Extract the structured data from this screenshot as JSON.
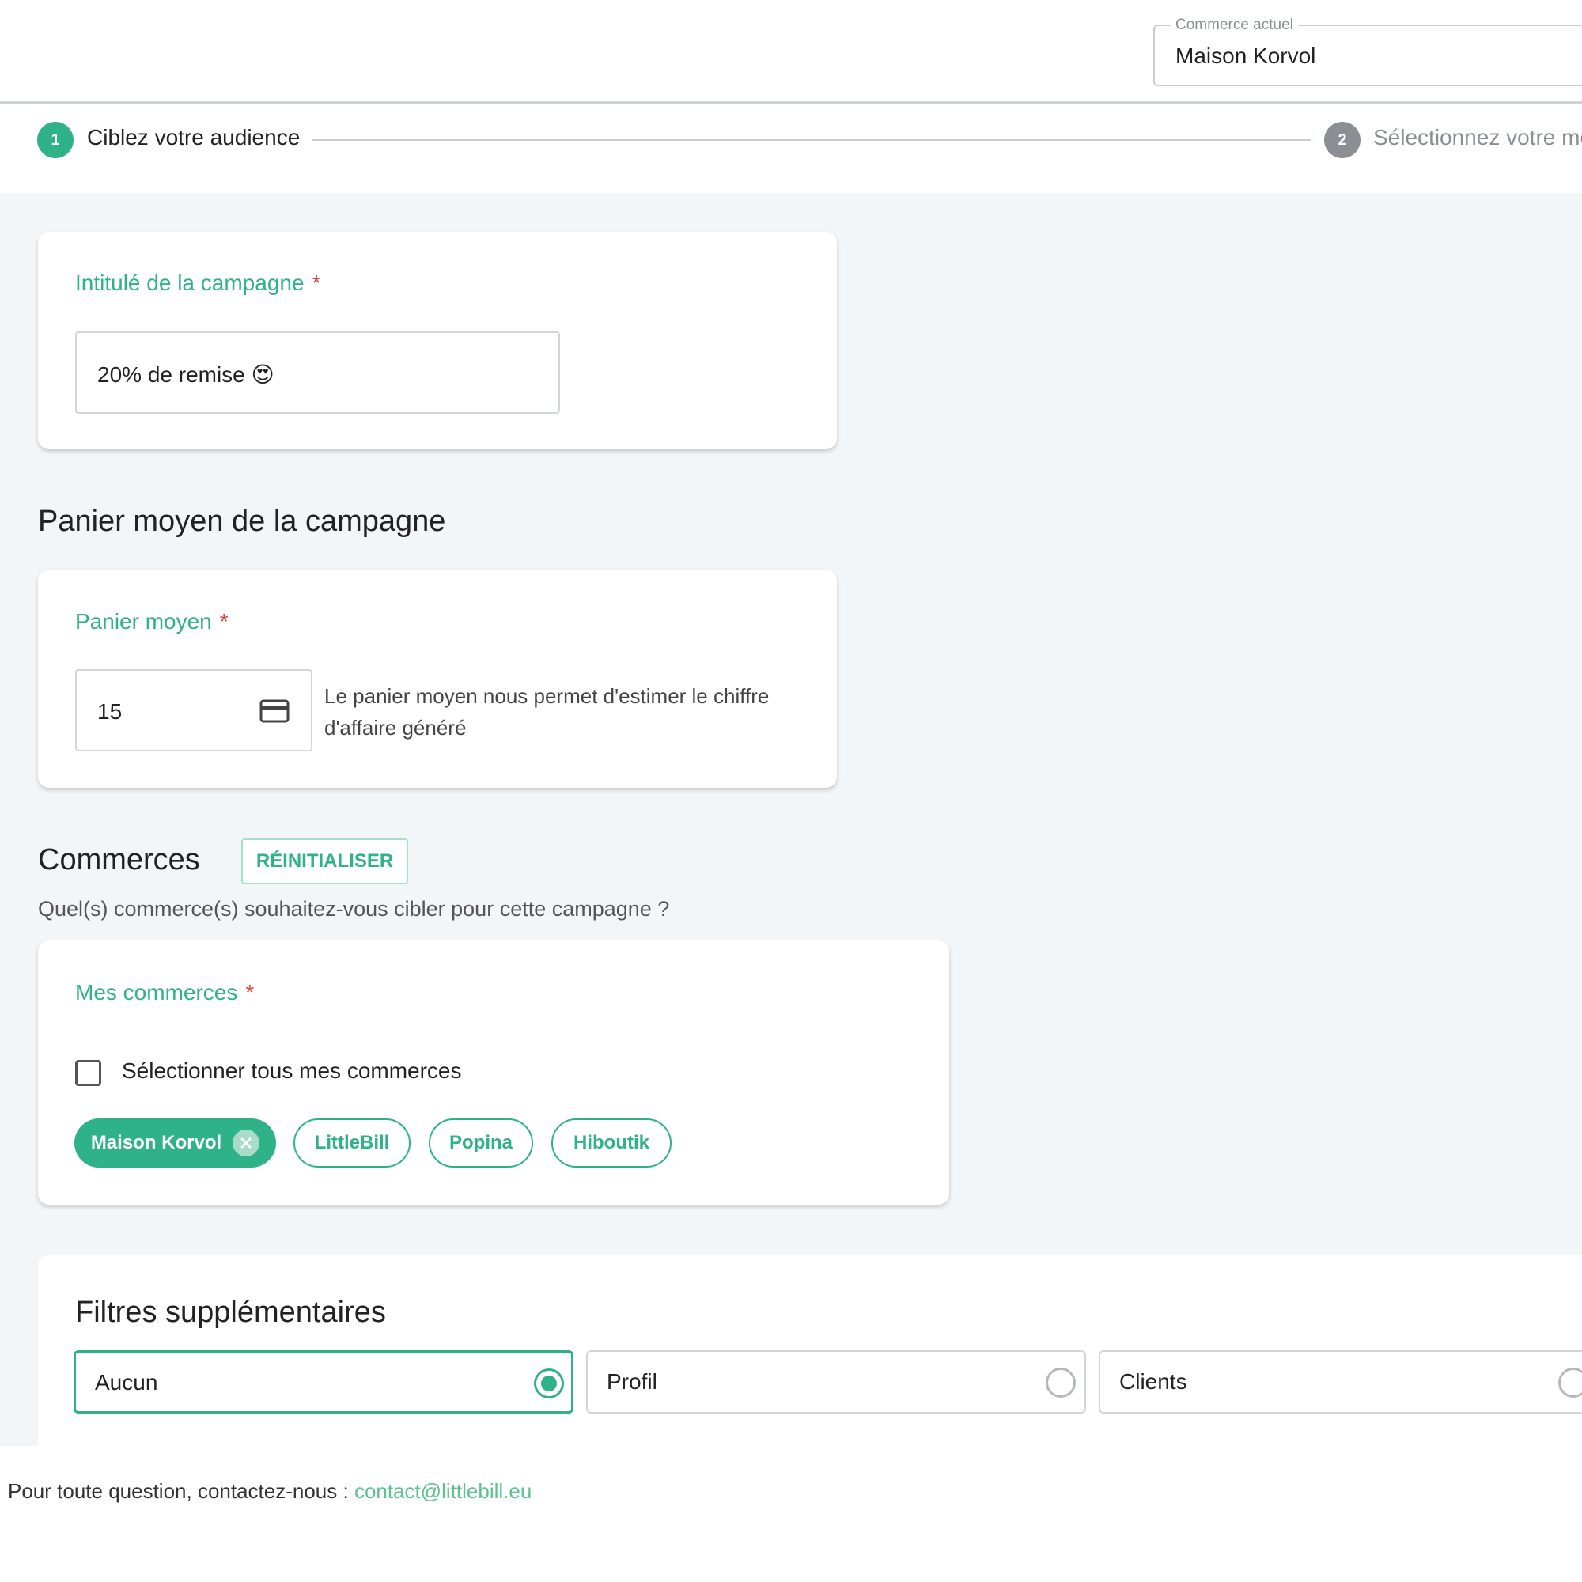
{
  "header": {
    "store_select": {
      "legend": "Commerce actuel",
      "value": "Maison Korvol"
    }
  },
  "stepper": {
    "steps": [
      {
        "number": "1",
        "label": "Ciblez votre audience",
        "state": "active"
      },
      {
        "number": "2",
        "label": "Sélectionnez votre me",
        "state": "inactive"
      }
    ]
  },
  "campaign_name": {
    "label": "Intitulé de la campagne",
    "required_mark": "*",
    "value": "20% de remise",
    "emoji": "😍"
  },
  "basket_section": {
    "title": "Panier moyen de la campagne",
    "label": "Panier moyen",
    "required_mark": "*",
    "value": "15",
    "help": "Le panier moyen nous permet d'estimer le chiffre d'affaire généré",
    "icon": "credit-card-icon"
  },
  "stores_section": {
    "title": "Commerces",
    "reset_label": "RÉINITIALISER",
    "subtitle": "Quel(s) commerce(s) souhaitez-vous cibler pour cette campagne ?",
    "field_label": "Mes commerces",
    "required_mark": "*",
    "select_all_label": "Sélectionner tous mes commerces",
    "select_all_checked": false,
    "chips": [
      {
        "label": "Maison Korvol",
        "selected": true
      },
      {
        "label": "LittleBill",
        "selected": false
      },
      {
        "label": "Popina",
        "selected": false
      },
      {
        "label": "Hiboutik",
        "selected": false
      }
    ]
  },
  "filters_section": {
    "title": "Filtres supplémentaires",
    "options": [
      {
        "label": "Aucun",
        "selected": true
      },
      {
        "label": "Profil",
        "selected": false
      },
      {
        "label": "Clients",
        "selected": false
      }
    ]
  },
  "footer": {
    "text": "Pour toute question, contactez-nous : ",
    "email": "contact@littlebill.eu"
  },
  "colors": {
    "accent": "#2fb287",
    "required": "#e0463e",
    "background": "#f3f6f9"
  }
}
